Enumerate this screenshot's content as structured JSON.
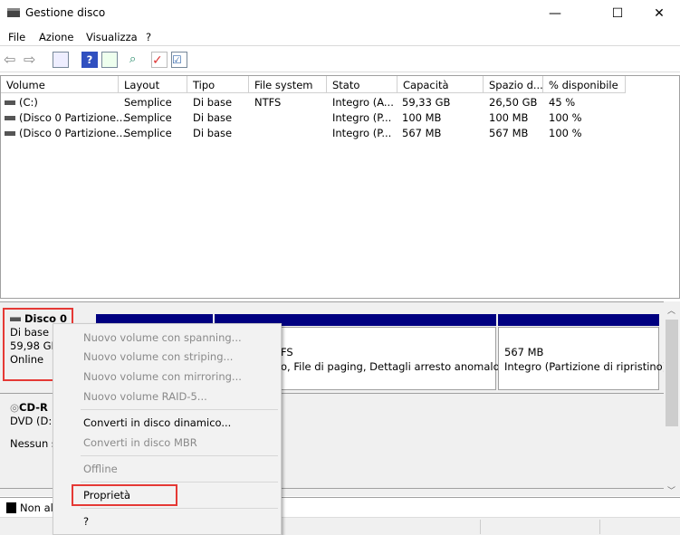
{
  "window": {
    "title": "Gestione disco",
    "minimize": "—",
    "maximize": "☐",
    "close": "✕"
  },
  "menu": [
    "File",
    "Azione",
    "Visualizza",
    "?"
  ],
  "toolbar": [
    "back-icon",
    "forward-icon",
    "console-tree-icon",
    "help-icon",
    "action-pane-icon",
    "connect-icon",
    "check-icon",
    "properties-icon"
  ],
  "columns": [
    "Volume",
    "Layout",
    "Tipo",
    "File system",
    "Stato",
    "Capacità",
    "Spazio d...",
    "% disponibile"
  ],
  "rows": [
    [
      "(C:)",
      "Semplice",
      "Di base",
      "NTFS",
      "Integro (A...",
      "59,33 GB",
      "26,50 GB",
      "45 %"
    ],
    [
      "(Disco 0 Partizione...",
      "Semplice",
      "Di base",
      "",
      "Integro (P...",
      "100 MB",
      "100 MB",
      "100 %"
    ],
    [
      "(Disco 0 Partizione...",
      "Semplice",
      "Di base",
      "",
      "Integro (P...",
      "567 MB",
      "567 MB",
      "100 %"
    ]
  ],
  "disk0": {
    "name": "Disco 0",
    "type": "Di base",
    "size": "59,98 GB",
    "status": "Online",
    "p2_line1": "FS",
    "p2_line2": "o, File di paging, Dettagli arresto anomalo d",
    "p3_size": "567 MB",
    "p3_status": "Integro (Partizione di ripristino)"
  },
  "cdrom": {
    "name": "CD-R",
    "type": "DVD (D:)",
    "status": "Nessun s"
  },
  "legend": {
    "unallocated": "Non al"
  },
  "context_menu": [
    {
      "label": "Nuovo volume con spanning...",
      "enabled": false
    },
    {
      "label": "Nuovo volume con striping...",
      "enabled": false
    },
    {
      "label": "Nuovo volume con mirroring...",
      "enabled": false
    },
    {
      "label": "Nuovo volume RAID-5...",
      "enabled": false
    },
    {
      "label": "Converti in disco dinamico...",
      "enabled": true
    },
    {
      "label": "Converti in disco MBR",
      "enabled": false
    },
    {
      "label": "Offline",
      "enabled": false
    },
    {
      "label": "Proprietà",
      "enabled": true,
      "highlighted": true
    },
    {
      "label": "?",
      "enabled": true
    }
  ],
  "colors": {
    "partition_bar": "#000080",
    "highlight": "#e53935"
  }
}
